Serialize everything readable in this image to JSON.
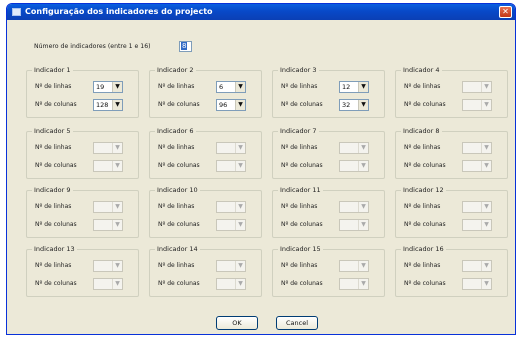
{
  "window": {
    "title": "Configuração dos indicadores do projecto",
    "close_glyph": "✕"
  },
  "count": {
    "label": "Número de indicadores (entre 1 e 16)",
    "value": "8"
  },
  "labels": {
    "rows": "Nº de linhas",
    "cols": "Nº de colunas"
  },
  "indicators": [
    {
      "title": "Indicador 1",
      "rows_value": "19",
      "cols_value": "128",
      "enabled": true
    },
    {
      "title": "Indicador 2",
      "rows_value": "6",
      "cols_value": "96",
      "enabled": true
    },
    {
      "title": "Indicador 3",
      "rows_value": "12",
      "cols_value": "32",
      "enabled": true
    },
    {
      "title": "Indicador 4",
      "rows_value": "",
      "cols_value": "",
      "enabled": false
    },
    {
      "title": "Indicador 5",
      "rows_value": "",
      "cols_value": "",
      "enabled": false
    },
    {
      "title": "Indicador 6",
      "rows_value": "",
      "cols_value": "",
      "enabled": false
    },
    {
      "title": "Indicador 7",
      "rows_value": "",
      "cols_value": "",
      "enabled": false
    },
    {
      "title": "Indicador 8",
      "rows_value": "",
      "cols_value": "",
      "enabled": false
    },
    {
      "title": "Indicador 9",
      "rows_value": "",
      "cols_value": "",
      "enabled": false
    },
    {
      "title": "Indicador 10",
      "rows_value": "",
      "cols_value": "",
      "enabled": false
    },
    {
      "title": "Indicador 11",
      "rows_value": "",
      "cols_value": "",
      "enabled": false
    },
    {
      "title": "Indicador 12",
      "rows_value": "",
      "cols_value": "",
      "enabled": false
    },
    {
      "title": "Indicador 13",
      "rows_value": "",
      "cols_value": "",
      "enabled": false
    },
    {
      "title": "Indicador 14",
      "rows_value": "",
      "cols_value": "",
      "enabled": false
    },
    {
      "title": "Indicador 15",
      "rows_value": "",
      "cols_value": "",
      "enabled": false
    },
    {
      "title": "Indicador 16",
      "rows_value": "",
      "cols_value": "",
      "enabled": false
    }
  ],
  "buttons": {
    "ok": "OK",
    "cancel": "Cancel"
  },
  "icons": {
    "combo_arrow": "▼"
  }
}
